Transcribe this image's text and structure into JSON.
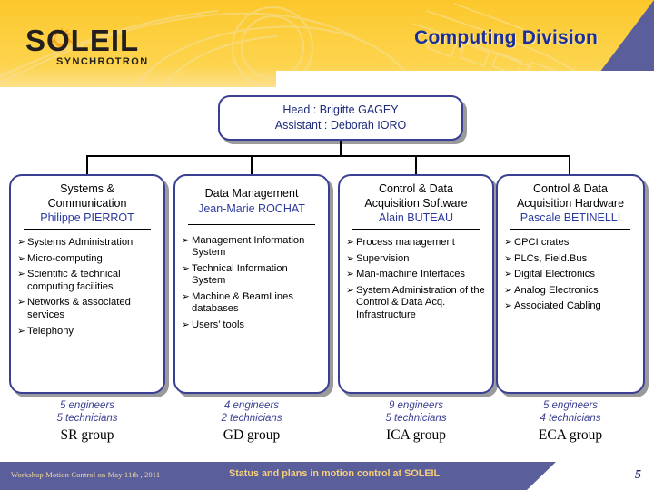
{
  "header": {
    "slide_title": "Computing Division",
    "logo": {
      "name": "SOLEIL",
      "subtitle": "SYNCHROTRON",
      "sun_icon": "sun-icon"
    },
    "colors": {
      "banner_yellow": "#fdcf3f",
      "banner_blue": "#5a5f9c",
      "title_blue": "#1c2f96"
    }
  },
  "chart": {
    "head_box": {
      "head_line": "Head : Brigitte GAGEY",
      "assistant_line": "Assistant : Deborah IORO"
    },
    "departments": [
      {
        "title": "Systems &\nCommunication",
        "title_line1": "Systems &",
        "title_line2": "Communication",
        "person": "Philippe PIERROT",
        "bullets": [
          "Systems Administration",
          "Micro-computing",
          "Scientific & technical computing facilities",
          "Networks &  associated services",
          "Telephony"
        ],
        "engineers": "5 engineers",
        "technicians": "5 technicians",
        "group": "SR group"
      },
      {
        "title_line1": "Data Management",
        "title_line2": "",
        "person": "Jean-Marie ROCHAT",
        "bullets": [
          "Management Information System",
          "Technical Information System",
          "Machine & BeamLines databases",
          "Users’ tools"
        ],
        "engineers": "4 engineers",
        "technicians": "2 technicians",
        "group": "GD group"
      },
      {
        "title_line1": "Control & Data",
        "title_line2": "Acquisition Software",
        "person": "Alain BUTEAU",
        "bullets": [
          "Process management",
          "Supervision",
          "Man-machine Interfaces",
          "System Administration of the Control & Data Acq. Infrastructure"
        ],
        "engineers": "9 engineers",
        "technicians": "5 technicians",
        "group": "ICA group"
      },
      {
        "title_line1": "Control & Data",
        "title_line2": "Acquisition Hardware",
        "person": "Pascale BETINELLI",
        "bullets": [
          "CPCI crates",
          "PLCs, Field.Bus",
          "Digital Electronics",
          "Analog Electronics",
          "Associated Cabling"
        ],
        "engineers": "5 engineers",
        "technicians": "4 technicians",
        "group": "ECA group"
      }
    ],
    "colors": {
      "box_border": "#3b3f93",
      "person_text": "#2b3aa0",
      "caption_text": "#3b3f93"
    }
  },
  "footer": {
    "left_text": "Workshop Motion Control on May 11th , 2011",
    "center_text": "Status and plans in motion control at SOLEIL",
    "page_number": "5"
  }
}
